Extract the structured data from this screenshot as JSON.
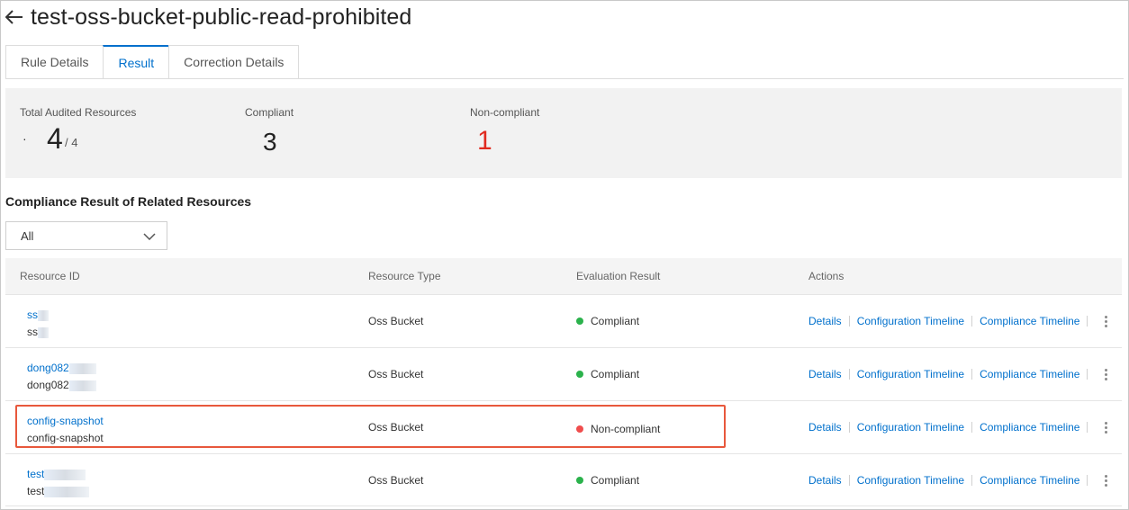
{
  "page": {
    "title": "test-oss-bucket-public-read-prohibited"
  },
  "tabs": [
    {
      "label": "Rule Details"
    },
    {
      "label": "Result",
      "active": true
    },
    {
      "label": "Correction Details"
    }
  ],
  "summary": {
    "total": {
      "label": "Total Audited Resources",
      "value": "4",
      "of": "/ 4",
      "mark": "·"
    },
    "compliant": {
      "label": "Compliant",
      "value": "3"
    },
    "non_compliant": {
      "label": "Non-compliant",
      "value": "1",
      "color": "#e02b20"
    }
  },
  "section": {
    "title": "Compliance Result of Related Resources"
  },
  "filter": {
    "value": "All"
  },
  "table": {
    "headers": [
      "Resource ID",
      "Resource Type",
      "Evaluation Result",
      "Actions"
    ],
    "rows": [
      {
        "id_link": "ss",
        "id_text": "ss",
        "type": "Oss Bucket",
        "result": "Compliant",
        "status_color": "#2bb24c"
      },
      {
        "id_link": "dong082",
        "id_text": "dong082",
        "type": "Oss Bucket",
        "result": "Compliant",
        "status_color": "#2bb24c"
      },
      {
        "id_link": "config-snapshot",
        "id_text": "config-snapshot",
        "type": "Oss Bucket",
        "result": "Non-compliant",
        "status_color": "#f04d4d"
      },
      {
        "id_link": "test",
        "id_text": "test",
        "type": "Oss Bucket",
        "result": "Compliant",
        "status_color": "#2bb24c"
      }
    ],
    "actions": {
      "details": "Details",
      "config_timeline": "Configuration Timeline",
      "compliance_timeline": "Compliance Timeline"
    }
  },
  "icons": {
    "back": "arrow-left-icon",
    "dropdown": "chevron-down-icon",
    "more": "more-vertical-icon"
  },
  "colors": {
    "accent": "#0070cc",
    "highlight": "#e8583c"
  }
}
